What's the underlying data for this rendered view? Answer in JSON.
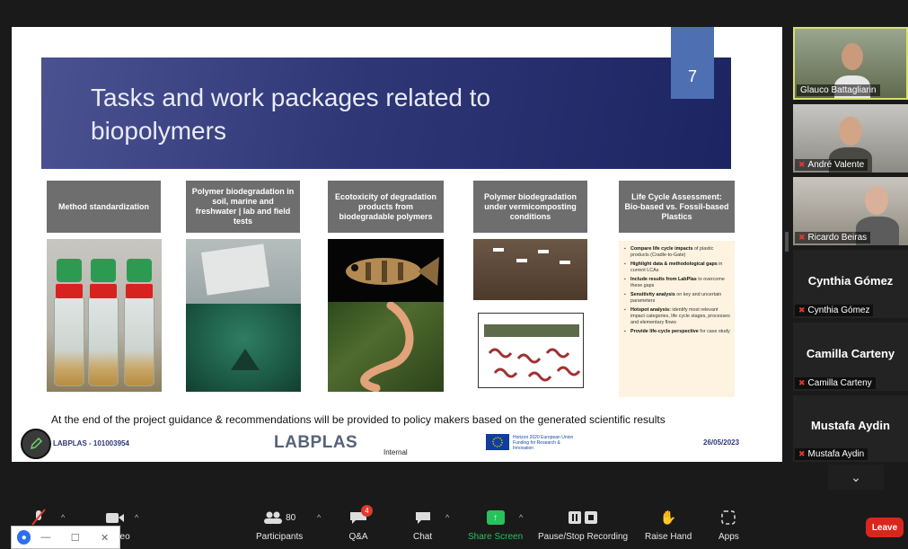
{
  "slide": {
    "title": "Tasks and work packages related to biopolymers",
    "number": "7",
    "columns": [
      {
        "heading": "Method standardization"
      },
      {
        "heading": "Polymer biodegradation in soil, marine and freshwater | lab and field tests"
      },
      {
        "heading": "Ecotoxicity of degradation products from biodegradable polymers"
      },
      {
        "heading": "Polymer biodegradation under vermicomposting conditions"
      },
      {
        "heading": "Life Cycle Assessment: Bio-based vs. Fossil-based Plastics"
      }
    ],
    "lca_items": [
      {
        "bold": "Compare life cycle impacts",
        "rest": " of plastic products (Cradle-to-Gate)"
      },
      {
        "bold": "Highlight data & methodological gaps",
        "rest": " in current LCAs"
      },
      {
        "bold": "Include results from LabPlas",
        "rest": " to overcome these gaps"
      },
      {
        "bold": "Sensitivity analysis",
        "rest": " on key and uncertain parameters"
      },
      {
        "bold": "Hotspot analysis:",
        "rest": " identify most relevant impact categories, life cycle stages, processes and elementary flows"
      },
      {
        "bold": "Provide life-cycle perspective",
        "rest": " for case study"
      }
    ],
    "footer": "At the end of the project guidance & recommendations will be provided to policy makers based on the generated scientific results",
    "project_id": "LABPLAS - 101003954",
    "logo_text": "LABPLAS",
    "internal_label": "Internal",
    "eu_text": "Horizon 2020 European Union Funding for Research & Innovation",
    "date": "26/05/2023"
  },
  "participants": [
    {
      "name": "Glauco Battagliarin",
      "muted": false
    },
    {
      "name": "André Valente",
      "muted": true
    },
    {
      "name": "Ricardo Beiras",
      "muted": true
    },
    {
      "name": "Cynthia Gómez",
      "display": "Cynthia Gómez",
      "muted": true
    },
    {
      "name": "Camilla Carteny",
      "display": "Camilla Carteny",
      "muted": true
    },
    {
      "name": "Mustafa Aydin",
      "display": "Mustafa Aydin",
      "muted": true
    }
  ],
  "toolbar": {
    "video_label": "deo",
    "participants_label": "Participants",
    "participants_count": "80",
    "qa_label": "Q&A",
    "qa_badge": "4",
    "chat_label": "Chat",
    "share_label": "Share Screen",
    "record_label": "Pause/Stop Recording",
    "raise_label": "Raise Hand",
    "apps_label": "Apps",
    "leave_label": "Leave"
  },
  "colors": {
    "banner": "#2f3777",
    "share_green": "#27c25c",
    "leave_red": "#d9261c",
    "active_speaker_border": "#d9e06a"
  }
}
